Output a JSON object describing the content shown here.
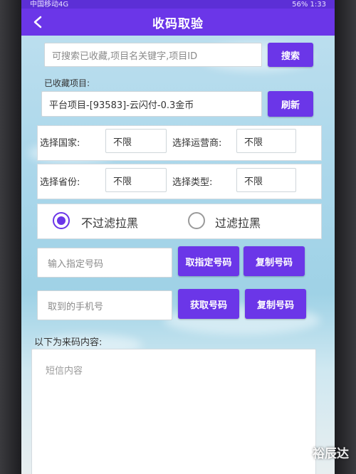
{
  "statusbar": {
    "left": "中国移动4G",
    "right": "56% 1:33"
  },
  "appbar": {
    "title": "收码取验"
  },
  "search": {
    "placeholder": "可搜索已收藏,项目名关键字,项目ID",
    "button": "搜索"
  },
  "favorites": {
    "label": "已收藏项目:",
    "value": "平台项目-[93583]-云闪付-0.3金币",
    "refresh": "刷新"
  },
  "filters": {
    "country_label": "选择国家:",
    "country_value": "不限",
    "carrier_label": "选择运营商:",
    "carrier_value": "不限",
    "province_label": "选择省份:",
    "province_value": "不限",
    "type_label": "选择类型:",
    "type_value": "不限"
  },
  "blacklist": {
    "option_no": "不过滤拉黑",
    "option_yes": "过滤拉黑",
    "selected": "no"
  },
  "specified": {
    "placeholder": "输入指定号码",
    "get_button": "取指定号码",
    "copy_button": "复制号码"
  },
  "phone": {
    "placeholder": "取到的手机号",
    "get_button": "获取号码",
    "copy_button": "复制号码"
  },
  "sms": {
    "label": "以下为来码内容:",
    "placeholder": "短信内容"
  },
  "watermark": "裕辰达",
  "colors": {
    "accent": "#6b36e8",
    "statusbar": "#5c2fd6"
  }
}
